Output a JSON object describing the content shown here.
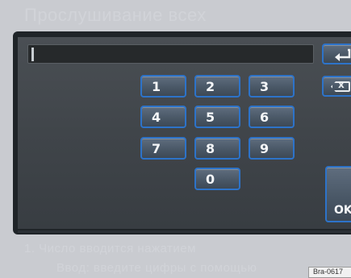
{
  "page": {
    "header_text": "Прослушивание всех",
    "caption_line1": "1. Число вводится нажатием",
    "caption_line2": "Ввод: введите цифры с помощью",
    "figure_ref": "Bra-0617"
  },
  "entry_field": {
    "value": ""
  },
  "keypad": {
    "keys": [
      "1",
      "2",
      "3",
      "4",
      "5",
      "6",
      "7",
      "8",
      "9",
      "0"
    ]
  },
  "side_buttons": {
    "back_icon": "return-arrow-icon",
    "delete_label": "x",
    "ok_label": "OK"
  },
  "colors": {
    "key_border": "#2d73c9",
    "screen_bg": "#40454a",
    "frame": "#1f2428"
  }
}
